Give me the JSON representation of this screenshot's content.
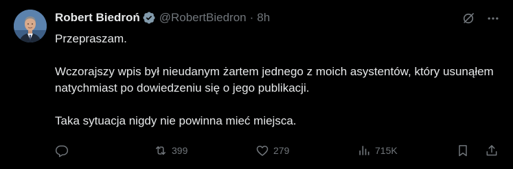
{
  "author": {
    "display_name": "Robert Biedroń",
    "handle": "@RobertBiedron",
    "separator": "·",
    "time": "8h",
    "verified": true,
    "avatar_bg": "#5a7fa8"
  },
  "body": {
    "paragraphs": [
      "Przepraszam.",
      "Wczorajszy wpis był nieudanym żartem jednego z moich asystentów, który usunąłem natychmiast po dowiedzeniu się o jego publikacji.",
      "Taka sytuacja nigdy nie powinna mieć miejsca."
    ]
  },
  "actions": {
    "reply": {
      "icon": "reply-icon",
      "count": ""
    },
    "repost": {
      "icon": "repost-icon",
      "count": "399"
    },
    "like": {
      "icon": "heart-icon",
      "count": "279"
    },
    "views": {
      "icon": "views-icon",
      "count": "715K"
    },
    "bookmark": {
      "icon": "bookmark-icon"
    },
    "share": {
      "icon": "share-icon"
    }
  },
  "colors": {
    "background": "#000000",
    "text_primary": "#e7e9ea",
    "text_secondary": "#71767b",
    "verified_badge": "#829aab"
  }
}
